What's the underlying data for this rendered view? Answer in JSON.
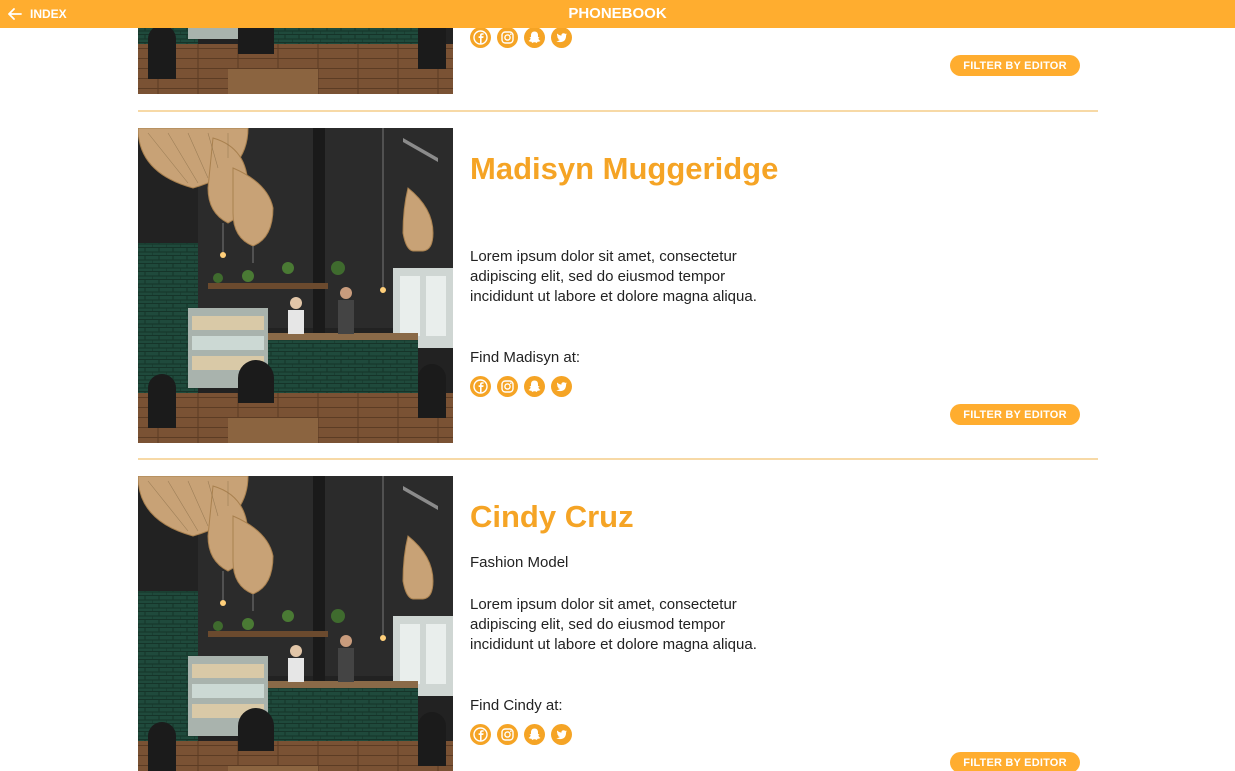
{
  "header": {
    "back_label": "INDEX",
    "title": "PHONEBOOK"
  },
  "theme": {
    "accent": "#ffad2f",
    "name_color": "#f5a425",
    "divider": "#f7d9a6"
  },
  "social_icons": [
    "facebook-icon",
    "instagram-icon",
    "snapchat-icon",
    "twitter-icon"
  ],
  "cards": [
    {
      "filter_label": "FILTER BY EDITOR"
    },
    {
      "name": "Madisyn Muggeridge",
      "subtitle": "",
      "bio": "Lorem ipsum dolor sit amet, consectetur adipiscing elit, sed do eiusmod tempor incididunt ut labore et dolore magna aliqua.",
      "find": "Find Madisyn at:",
      "filter_label": "FILTER BY EDITOR"
    },
    {
      "name": "Cindy Cruz",
      "subtitle": "Fashion Model",
      "bio": "Lorem ipsum dolor sit amet, consectetur adipiscing elit, sed do eiusmod tempor incididunt ut labore et dolore magna aliqua.",
      "find": "Find Cindy at:",
      "filter_label": "FILTER BY EDITOR"
    }
  ]
}
